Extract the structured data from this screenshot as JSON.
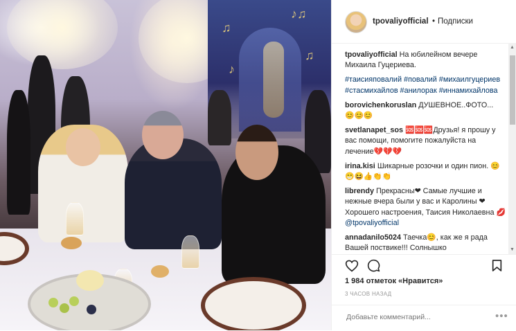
{
  "header": {
    "username": "tpovaliyofficial",
    "separator": "•",
    "follow_status": "Подписки"
  },
  "caption": {
    "username": "tpovaliyofficial",
    "text": "На юбилейном вечере Михаила Гуцериева.",
    "hashtags": "#таисияповалий #повалий #михаилгуцериев #стасмихайлов #анилорак #иннамихайлова"
  },
  "comments": [
    {
      "username": "borovichenkoruslan",
      "text": "ДУШЕВНОЕ..ФОТО...",
      "emoji": "😊😊😊"
    },
    {
      "username": "svetlanapet_sos",
      "text": "🆘🆘🆘Друзья! я прошу у вас помощи, помогите пожалуйста на лечение💔💔💔"
    },
    {
      "username": "irina.kisi",
      "text": "Шикарные розочки и один пион. 😊😁😆👍👏👏"
    },
    {
      "username": "librendy",
      "text": "Прекрасны❤ Самые лучшие и нежные вчера были у вас и Каролины ❤ Хорошего настроения, Таисия Николаевна 💋",
      "mention": "@tpovaliyofficial"
    },
    {
      "username": "annadanilo5024",
      "text": "Таечка😊, как же я рада Вашей поствике!!! Солнышко"
    }
  ],
  "actions": {
    "like_icon": "heart-icon",
    "comment_icon": "comment-icon",
    "save_icon": "bookmark-icon"
  },
  "likes_text": "1 984 отметок «Нравится»",
  "timestamp": "3 ЧАСОВ НАЗАД",
  "add_comment": {
    "placeholder": "Добавьте комментарий...",
    "more_label": "•••"
  },
  "colors": {
    "link": "#003569",
    "border": "#efefef",
    "muted": "#999999"
  }
}
